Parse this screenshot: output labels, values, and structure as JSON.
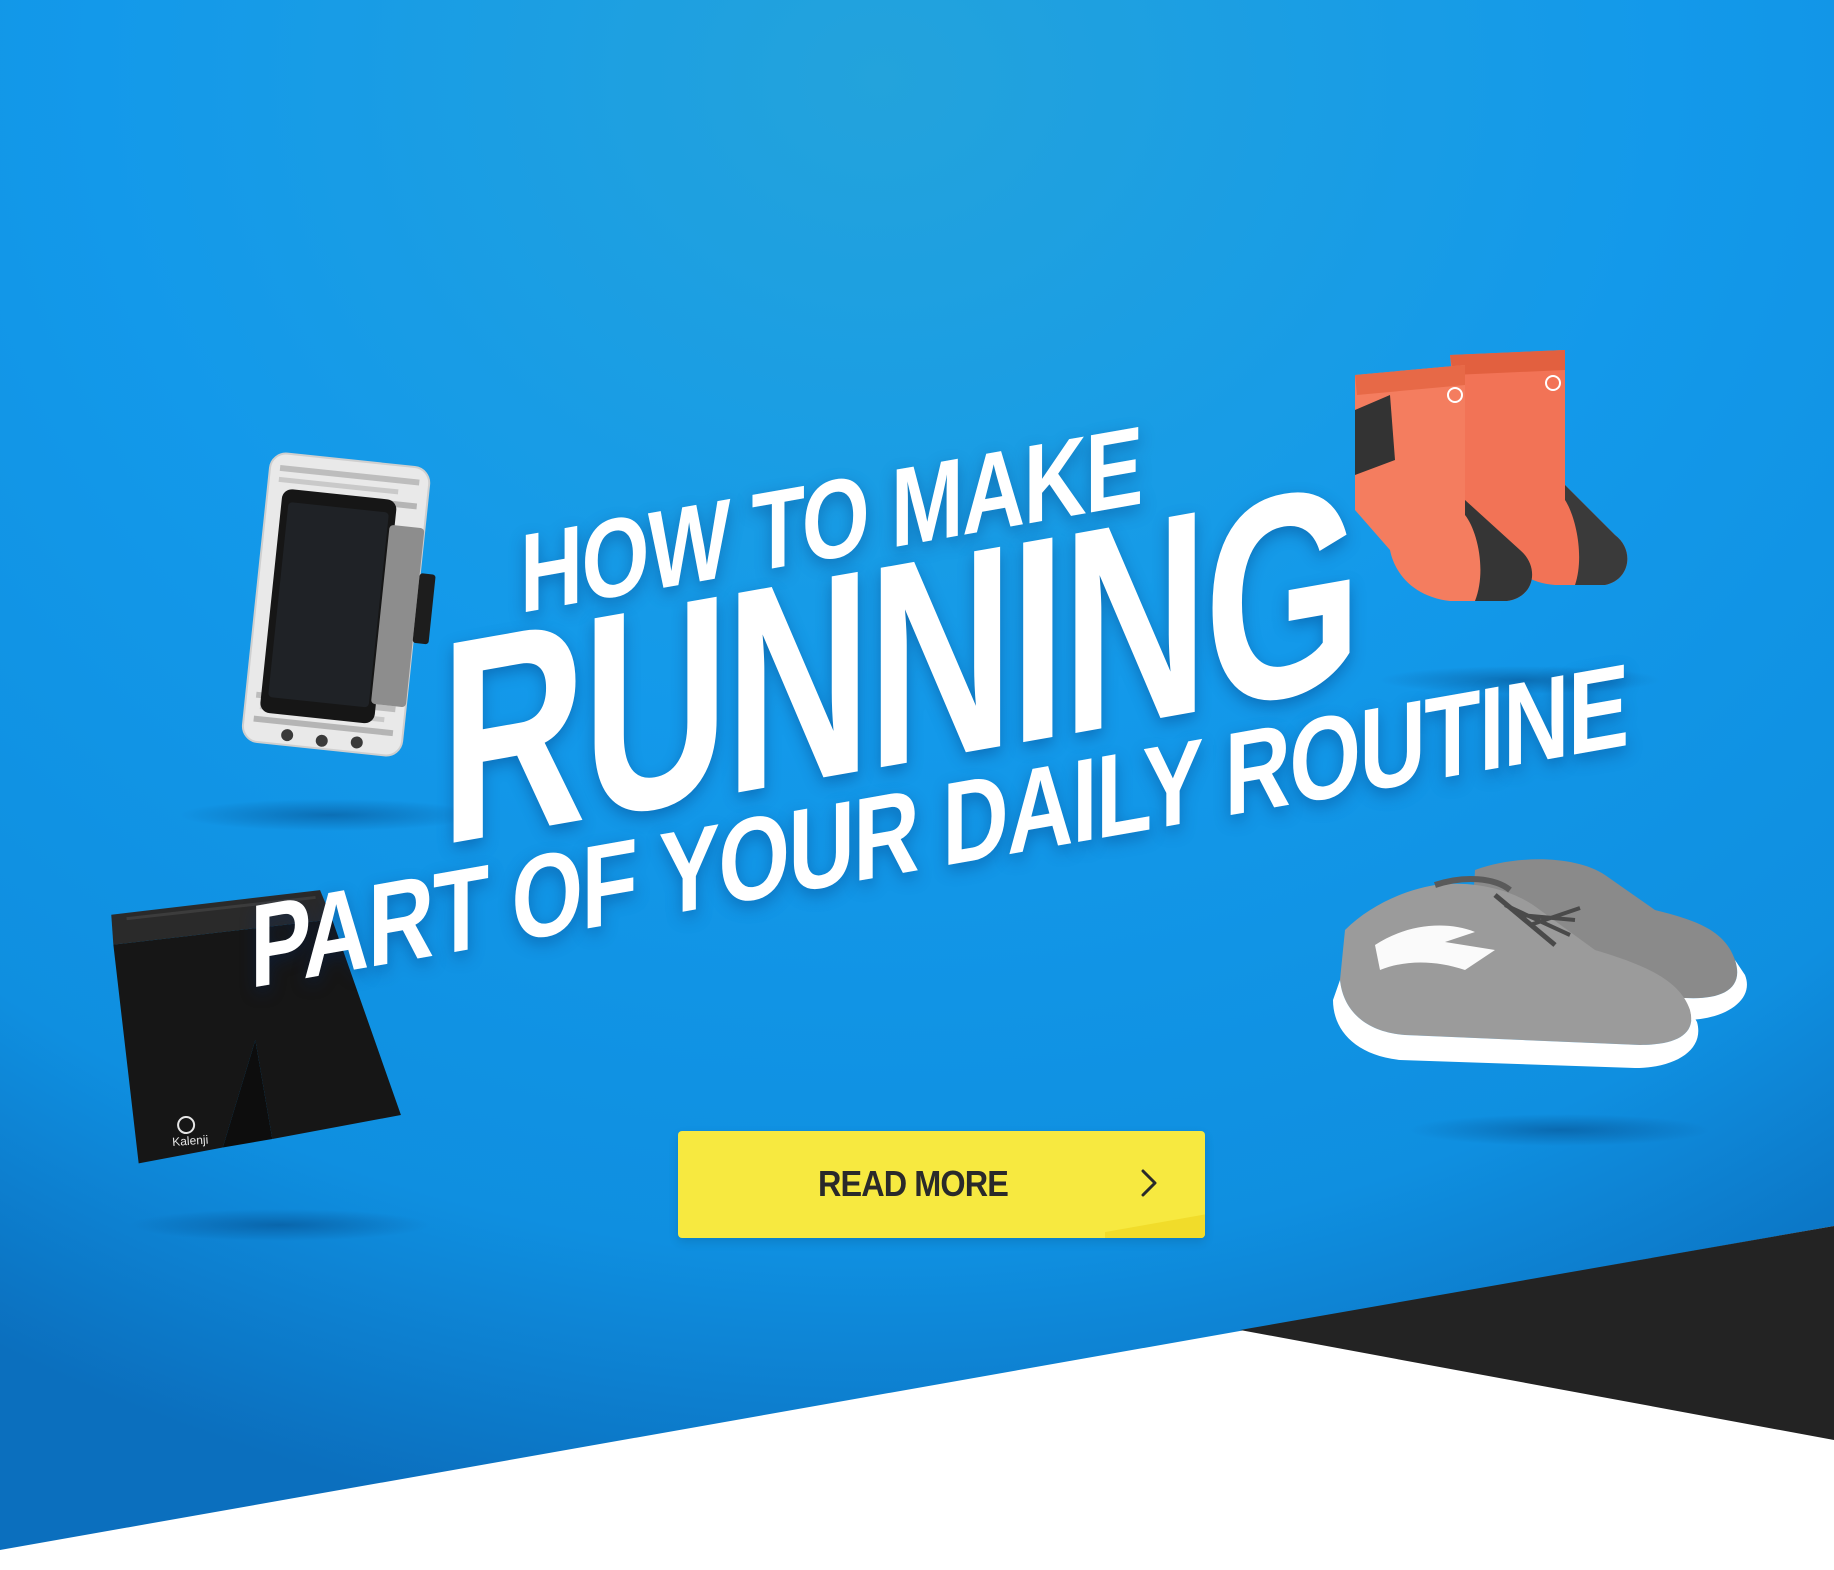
{
  "banner": {
    "headline_line1": "HOW TO MAKE",
    "headline_line2": "RUNNING",
    "headline_line3": "PART OF YOUR DAILY ROUTINE",
    "cta_label": "READ MORE",
    "cta_icon": "chevron-right-icon",
    "colors": {
      "background_blue": "#1494e6",
      "background_blue_light": "#22a2dc",
      "cta_yellow": "#f7e940",
      "dark_band": "#232323",
      "headline_text": "#ffffff"
    }
  },
  "products": [
    {
      "name": "phone-armband"
    },
    {
      "name": "running-socks"
    },
    {
      "name": "running-shorts",
      "brand_text": "Kalenji"
    },
    {
      "name": "running-shoes"
    }
  ]
}
